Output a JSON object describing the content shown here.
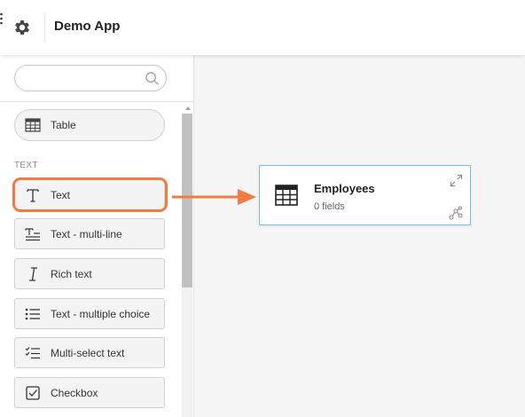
{
  "header": {
    "app_title": "Demo App"
  },
  "sidebar": {
    "search": {
      "value": "",
      "placeholder": ""
    },
    "table_item": {
      "label": "Table",
      "icon": "table-icon"
    },
    "section_label": "TEXT",
    "items": [
      {
        "label": "Text",
        "icon": "text-icon",
        "highlighted": true
      },
      {
        "label": "Text - multi-line",
        "icon": "multiline-text-icon"
      },
      {
        "label": "Rich text",
        "icon": "rich-text-icon"
      },
      {
        "label": "Text - multiple choice",
        "icon": "list-icon"
      },
      {
        "label": "Multi-select text",
        "icon": "checklist-icon"
      },
      {
        "label": "Checkbox",
        "icon": "checkbox-icon"
      }
    ]
  },
  "canvas": {
    "card": {
      "title": "Employees",
      "subtitle": "0 fields",
      "icon": "table-icon",
      "border_color": "#74c3dd"
    }
  },
  "colors": {
    "accent": "#ef7b45",
    "card_border": "#74c3dd"
  }
}
